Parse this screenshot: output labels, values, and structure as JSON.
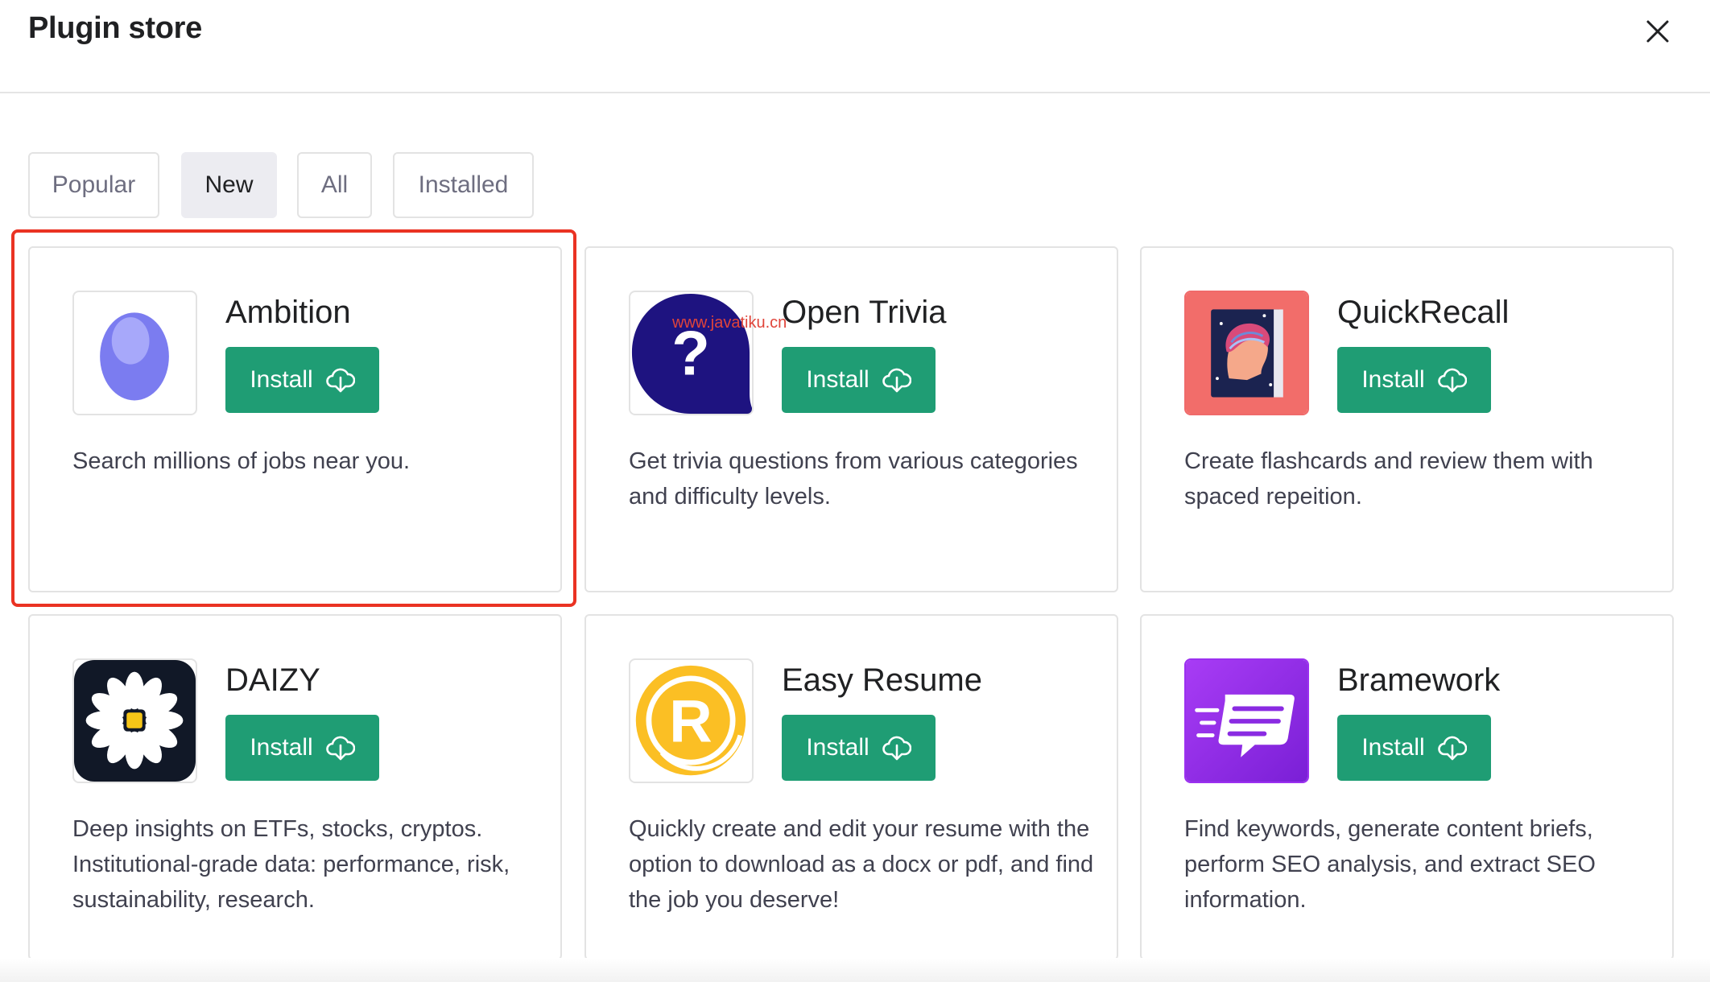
{
  "header": {
    "title": "Plugin store"
  },
  "tabs": [
    {
      "label": "Popular",
      "active": false
    },
    {
      "label": "New",
      "active": true
    },
    {
      "label": "All",
      "active": false
    },
    {
      "label": "Installed",
      "active": false
    }
  ],
  "plugins": [
    {
      "name": "Ambition",
      "install_label": "Install",
      "icon": "egg-icon",
      "highlighted": true,
      "description": "Search millions of jobs near you."
    },
    {
      "name": "Open Trivia",
      "install_label": "Install",
      "icon": "question-bubble-icon",
      "description": "Get trivia questions from various categories and difficulty levels."
    },
    {
      "name": "QuickRecall",
      "install_label": "Install",
      "icon": "flashcard-book-icon",
      "description": "Create flashcards and review them with spaced repeition."
    },
    {
      "name": "DAIZY",
      "install_label": "Install",
      "icon": "daisy-flower-icon",
      "description": "Deep insights on ETFs, stocks, cryptos. Institutional-grade data: performance, risk, sustainability, research."
    },
    {
      "name": "Easy Resume",
      "install_label": "Install",
      "icon": "resume-r-icon",
      "description": "Quickly create and edit your resume with the option to download as a docx or pdf, and find the job you deserve!"
    },
    {
      "name": "Bramework",
      "install_label": "Install",
      "icon": "speech-bubble-lines-icon",
      "description": "Find keywords, generate content briefs, perform SEO analysis, and extract SEO information."
    }
  ],
  "watermark": "www.javatiku.cn",
  "colors": {
    "install_button": "#1f9d74",
    "highlight_border": "#ea3323",
    "active_tab": "#ececf1"
  }
}
